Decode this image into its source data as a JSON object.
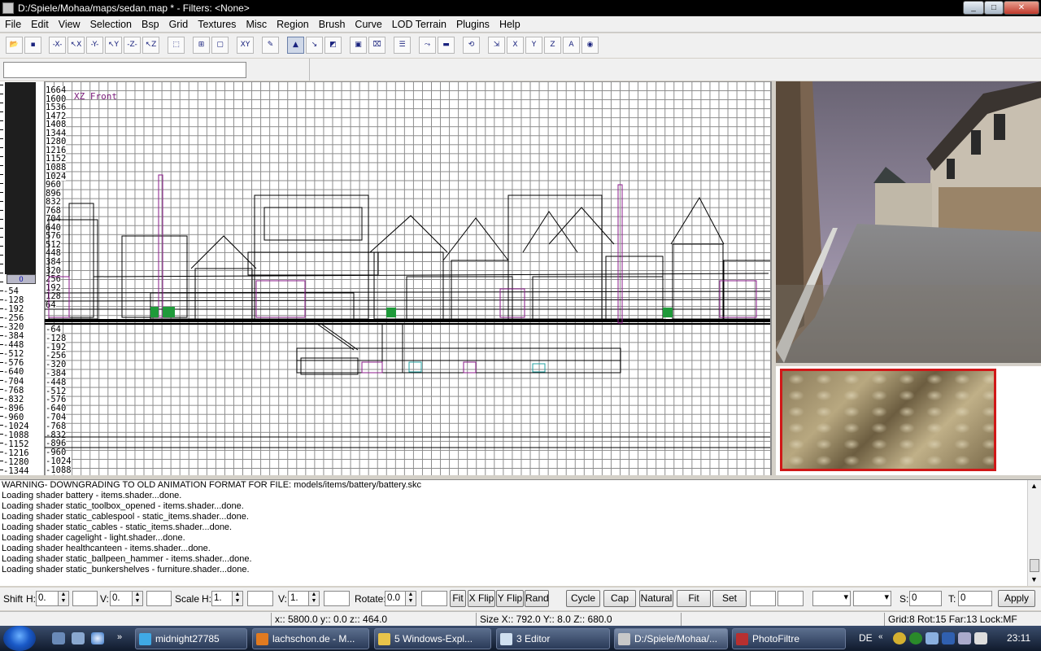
{
  "window": {
    "title": "D:/Spiele/Mohaa/maps/sedan.map * - Filters: <None>",
    "buttons": [
      "_",
      "□",
      "✕"
    ]
  },
  "menu": [
    "File",
    "Edit",
    "View",
    "Selection",
    "Bsp",
    "Grid",
    "Textures",
    "Misc",
    "Region",
    "Brush",
    "Curve",
    "LOD Terrain",
    "Plugins",
    "Help"
  ],
  "toolbar_icons": [
    "open-icon",
    "save-icon",
    "x-axis-icon",
    "x-flip-icon",
    "y-axis-icon",
    "y-flip-icon",
    "z-axis-icon",
    "z-flip-icon",
    "dotted-select-icon",
    "grid-select-icon",
    "dashed-select-icon",
    "swap-xy-icon",
    "clipper-icon",
    "camera-select-icon",
    "drag-icon",
    "edit-icon",
    "texture-icon",
    "entity-icon",
    "list-icon",
    "path-icon",
    "ruler-icon",
    "rotate-icon",
    "scale-icon",
    "x-view-icon",
    "y-view-icon",
    "z-view-icon",
    "text-icon",
    "eye-icon"
  ],
  "zscale_labels": [
    "-54",
    "-128",
    "-192",
    "-256",
    "-320",
    "-384",
    "-448",
    "-512",
    "-576",
    "-640",
    "-704",
    "-768",
    "-832",
    "-896",
    "-960",
    "-1024",
    "-1088",
    "-1152",
    "-1216",
    "-1280",
    "-1344"
  ],
  "zscale_marker": "0",
  "grid_view": {
    "name": "XZ Front",
    "y_labels_top": [
      "1664",
      "1600",
      "1536",
      "1472",
      "1408",
      "1344",
      "1280",
      "1216",
      "1152",
      "1088",
      "1024",
      "960",
      "896",
      "832",
      "768",
      "704",
      "640",
      "576",
      "512",
      "448",
      "384",
      "320",
      "256",
      "192",
      "128",
      "64"
    ],
    "y_labels_bottom": [
      "-64",
      "-128",
      "-192",
      "-256",
      "-320",
      "-384",
      "-448",
      "-512",
      "-576",
      "-640",
      "-704",
      "-768",
      "-832",
      "-896",
      "-960",
      "-1024",
      "-1088"
    ]
  },
  "console": {
    "lines": [
      "WARNING- DOWNGRADING TO OLD ANIMATION FORMAT FOR FILE: models/items/battery/battery.skc",
      "Loading shader battery - items.shader...done.",
      "Loading shader static_toolbox_opened - items.shader...done.",
      "Loading shader static_cablespool - static_items.shader...done.",
      "Loading shader static_cables - static_items.shader...done.",
      "Loading shader cagelight - light.shader...done.",
      "Loading shader healthcanteen - items.shader...done.",
      "Loading shader static_ballpeen_hammer - items.shader...done.",
      "Loading shader static_bunkershelves - furniture.shader...done."
    ]
  },
  "surface": {
    "shift_label": "Shift",
    "h_label": "H:",
    "shift_h": "0.",
    "v_label": "V:",
    "shift_v": "0.",
    "scale_label": "Scale",
    "scale_h_label": "H:",
    "scale_h": "1.",
    "scale_v_label": "V:",
    "scale_v": "1.",
    "rotate_label": "Rotate:",
    "rotate": "0.0",
    "fit_label": "Fit",
    "xflip_label": "X Flip",
    "yflip_label": "Y Flip",
    "rand_label": "Rand",
    "cycle_label": "Cycle >",
    "cap_label": "Cap",
    "natural_label": "Natural",
    "fit2_label": "Fit",
    "set_label": "Set",
    "s_label": "S:",
    "s_value": "0",
    "t_label": "T:",
    "t_value": "0",
    "apply_label": "Apply"
  },
  "status": {
    "coords": "x:: 5800.0  y:: 0.0  z:: 464.0",
    "size": "Size X:: 792.0  Y:: 8.0  Z:: 680.0",
    "grid": "Grid:8 Rot:15 Far:13 Lock:MF"
  },
  "taskbar": {
    "tasks": [
      {
        "label": "midnight27785",
        "icon_color": "#3fa9e6",
        "icon": "messenger-icon"
      },
      {
        "label": "lachschon.de - M...",
        "icon_color": "#e07a20",
        "icon": "firefox-icon"
      },
      {
        "label": "5 Windows-Expl...",
        "icon_color": "#e8c44a",
        "icon": "folder-icon"
      },
      {
        "label": "3 Editor",
        "icon_color": "#d0e0f0",
        "icon": "notepad-icon"
      },
      {
        "label": "D:/Spiele/Mohaa/...",
        "icon_color": "#c8c8c8",
        "icon": "radiant-icon",
        "active": true
      },
      {
        "label": "PhotoFiltre",
        "icon_color": "#b83030",
        "icon": "photofiltre-icon"
      }
    ],
    "lang": "DE",
    "clock": "23:11"
  }
}
